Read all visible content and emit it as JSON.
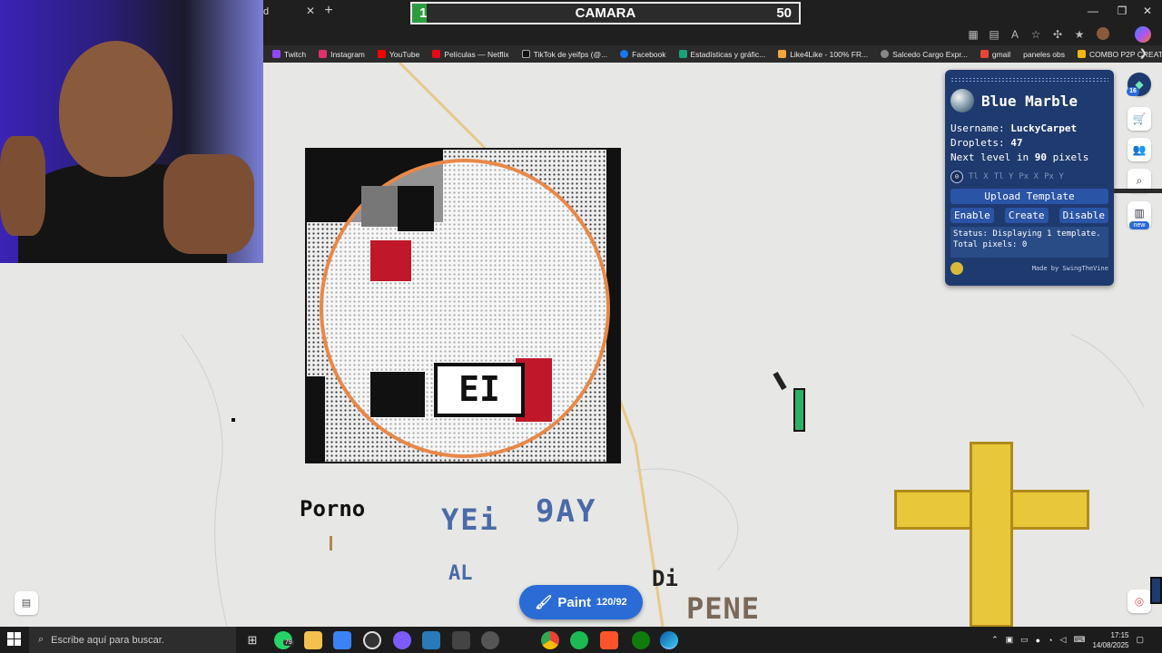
{
  "browser": {
    "tab_title": "d",
    "tab_close": "✕",
    "new_tab": "+"
  },
  "window_controls": {
    "minimize": "—",
    "maximize": "❐",
    "close": "✕"
  },
  "bookmarks": [
    {
      "label": "Twitch",
      "color": "#9146ff"
    },
    {
      "label": "Instagram",
      "color": "#e1306c"
    },
    {
      "label": "YouTube",
      "color": "#ff0000"
    },
    {
      "label": "Películas — Netflix",
      "color": "#e50914"
    },
    {
      "label": "TikTok de yeifps (@...",
      "color": "#111111"
    },
    {
      "label": "Facebook",
      "color": "#1877f2"
    },
    {
      "label": "Estadísticas y gráfic...",
      "color": "#1aa37a"
    },
    {
      "label": "Like4Like - 100% FR...",
      "color": "#f2a73b"
    },
    {
      "label": "Salcedo Cargo Expr...",
      "color": "#888888"
    },
    {
      "label": "gmail",
      "color": "#ea4335"
    },
    {
      "label": "paneles obs",
      "color": "#555555"
    },
    {
      "label": "COMBO P2P CREAT...",
      "color": "#f0b90b"
    }
  ],
  "bookmarks_more": "❯",
  "scoreboard": {
    "left": "1",
    "title": "CAMARA",
    "right": "50"
  },
  "map_texts": {
    "porno": "Porno",
    "yei": "YEi",
    "gay": "9AY",
    "al": "AL",
    "di": "Di",
    "pene": "PENE",
    "art_text": "EI"
  },
  "blue_marble": {
    "title": "Blue Marble",
    "username_label": "Username:",
    "username": "LuckyCarpet",
    "droplets_label": "Droplets:",
    "droplets": "47",
    "next_level_prefix": "Next level in",
    "next_level_value": "90",
    "next_level_suffix": "pixels",
    "coords": [
      "Tl X",
      "Tl Y",
      "Px X",
      "Px Y"
    ],
    "upload": "Upload Template",
    "enable": "Enable",
    "create": "Create",
    "disable": "Disable",
    "status": "Status: Displaying 1 template.",
    "status2": "Total pixels: 0",
    "made_by": "Made by SwingTheVine"
  },
  "rail": {
    "badge": "16",
    "new_label": "new"
  },
  "paint": {
    "label": "Paint",
    "count": "120/92"
  },
  "taskbar": {
    "search_placeholder": "Escribe aquí para buscar.",
    "whatsapp_badge": "79",
    "time": "17:15",
    "date": "14/08/2025"
  }
}
